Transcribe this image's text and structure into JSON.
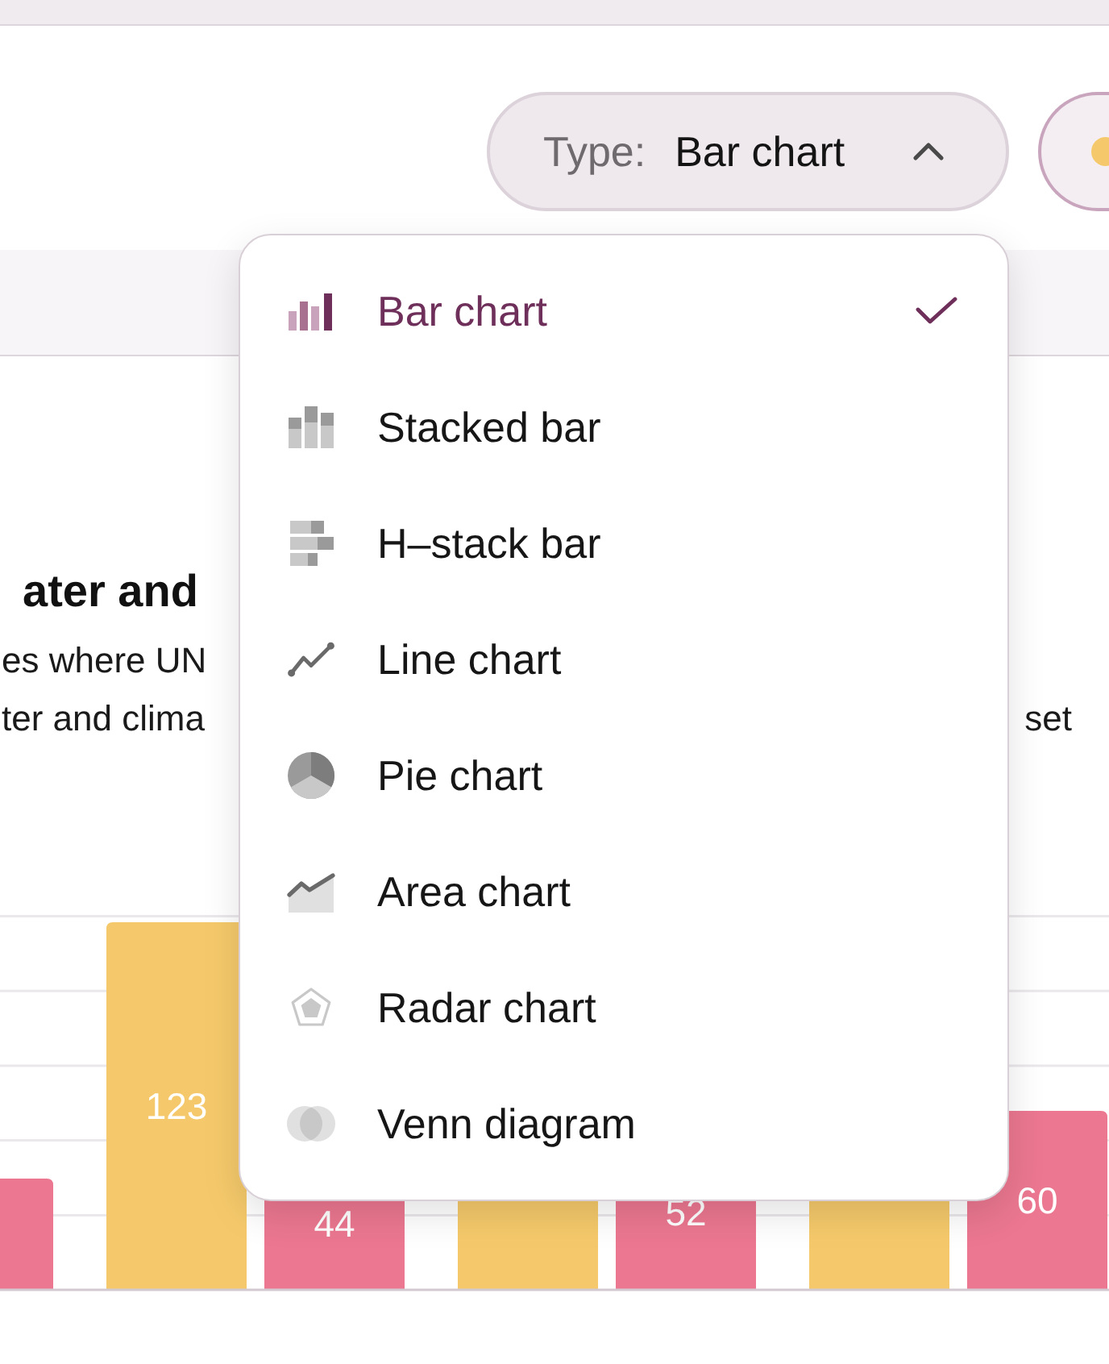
{
  "type_select": {
    "label": "Type:",
    "value": "Bar chart",
    "expanded": true
  },
  "legend_pills": [
    {
      "color": "#f5c96b"
    }
  ],
  "article": {
    "heading": "ater and",
    "lines": [
      {
        "left": "es where UN"
      },
      {
        "left": "ter and clima",
        "right": "set"
      }
    ]
  },
  "chart": {
    "bars": [
      {
        "color": "#eb7790"
      },
      {
        "color": "#f5c96b",
        "label": "123"
      },
      {
        "color": "#eb7790",
        "label": "44"
      },
      {
        "color": "#f5c96b"
      },
      {
        "color": "#eb7790",
        "label": "52"
      },
      {
        "color": "#f5c96b"
      },
      {
        "color": "#eb7790",
        "label": "60"
      }
    ]
  },
  "type_menu": {
    "items": [
      {
        "kind": "bar",
        "label": "Bar chart",
        "selected": true
      },
      {
        "kind": "stacked",
        "label": "Stacked bar",
        "selected": false
      },
      {
        "kind": "hstack",
        "label": "H–stack bar",
        "selected": false
      },
      {
        "kind": "line",
        "label": "Line chart",
        "selected": false
      },
      {
        "kind": "pie",
        "label": "Pie chart",
        "selected": false
      },
      {
        "kind": "area",
        "label": "Area chart",
        "selected": false
      },
      {
        "kind": "radar",
        "label": "Radar chart",
        "selected": false
      },
      {
        "kind": "venn",
        "label": "Venn diagram",
        "selected": false
      }
    ]
  }
}
